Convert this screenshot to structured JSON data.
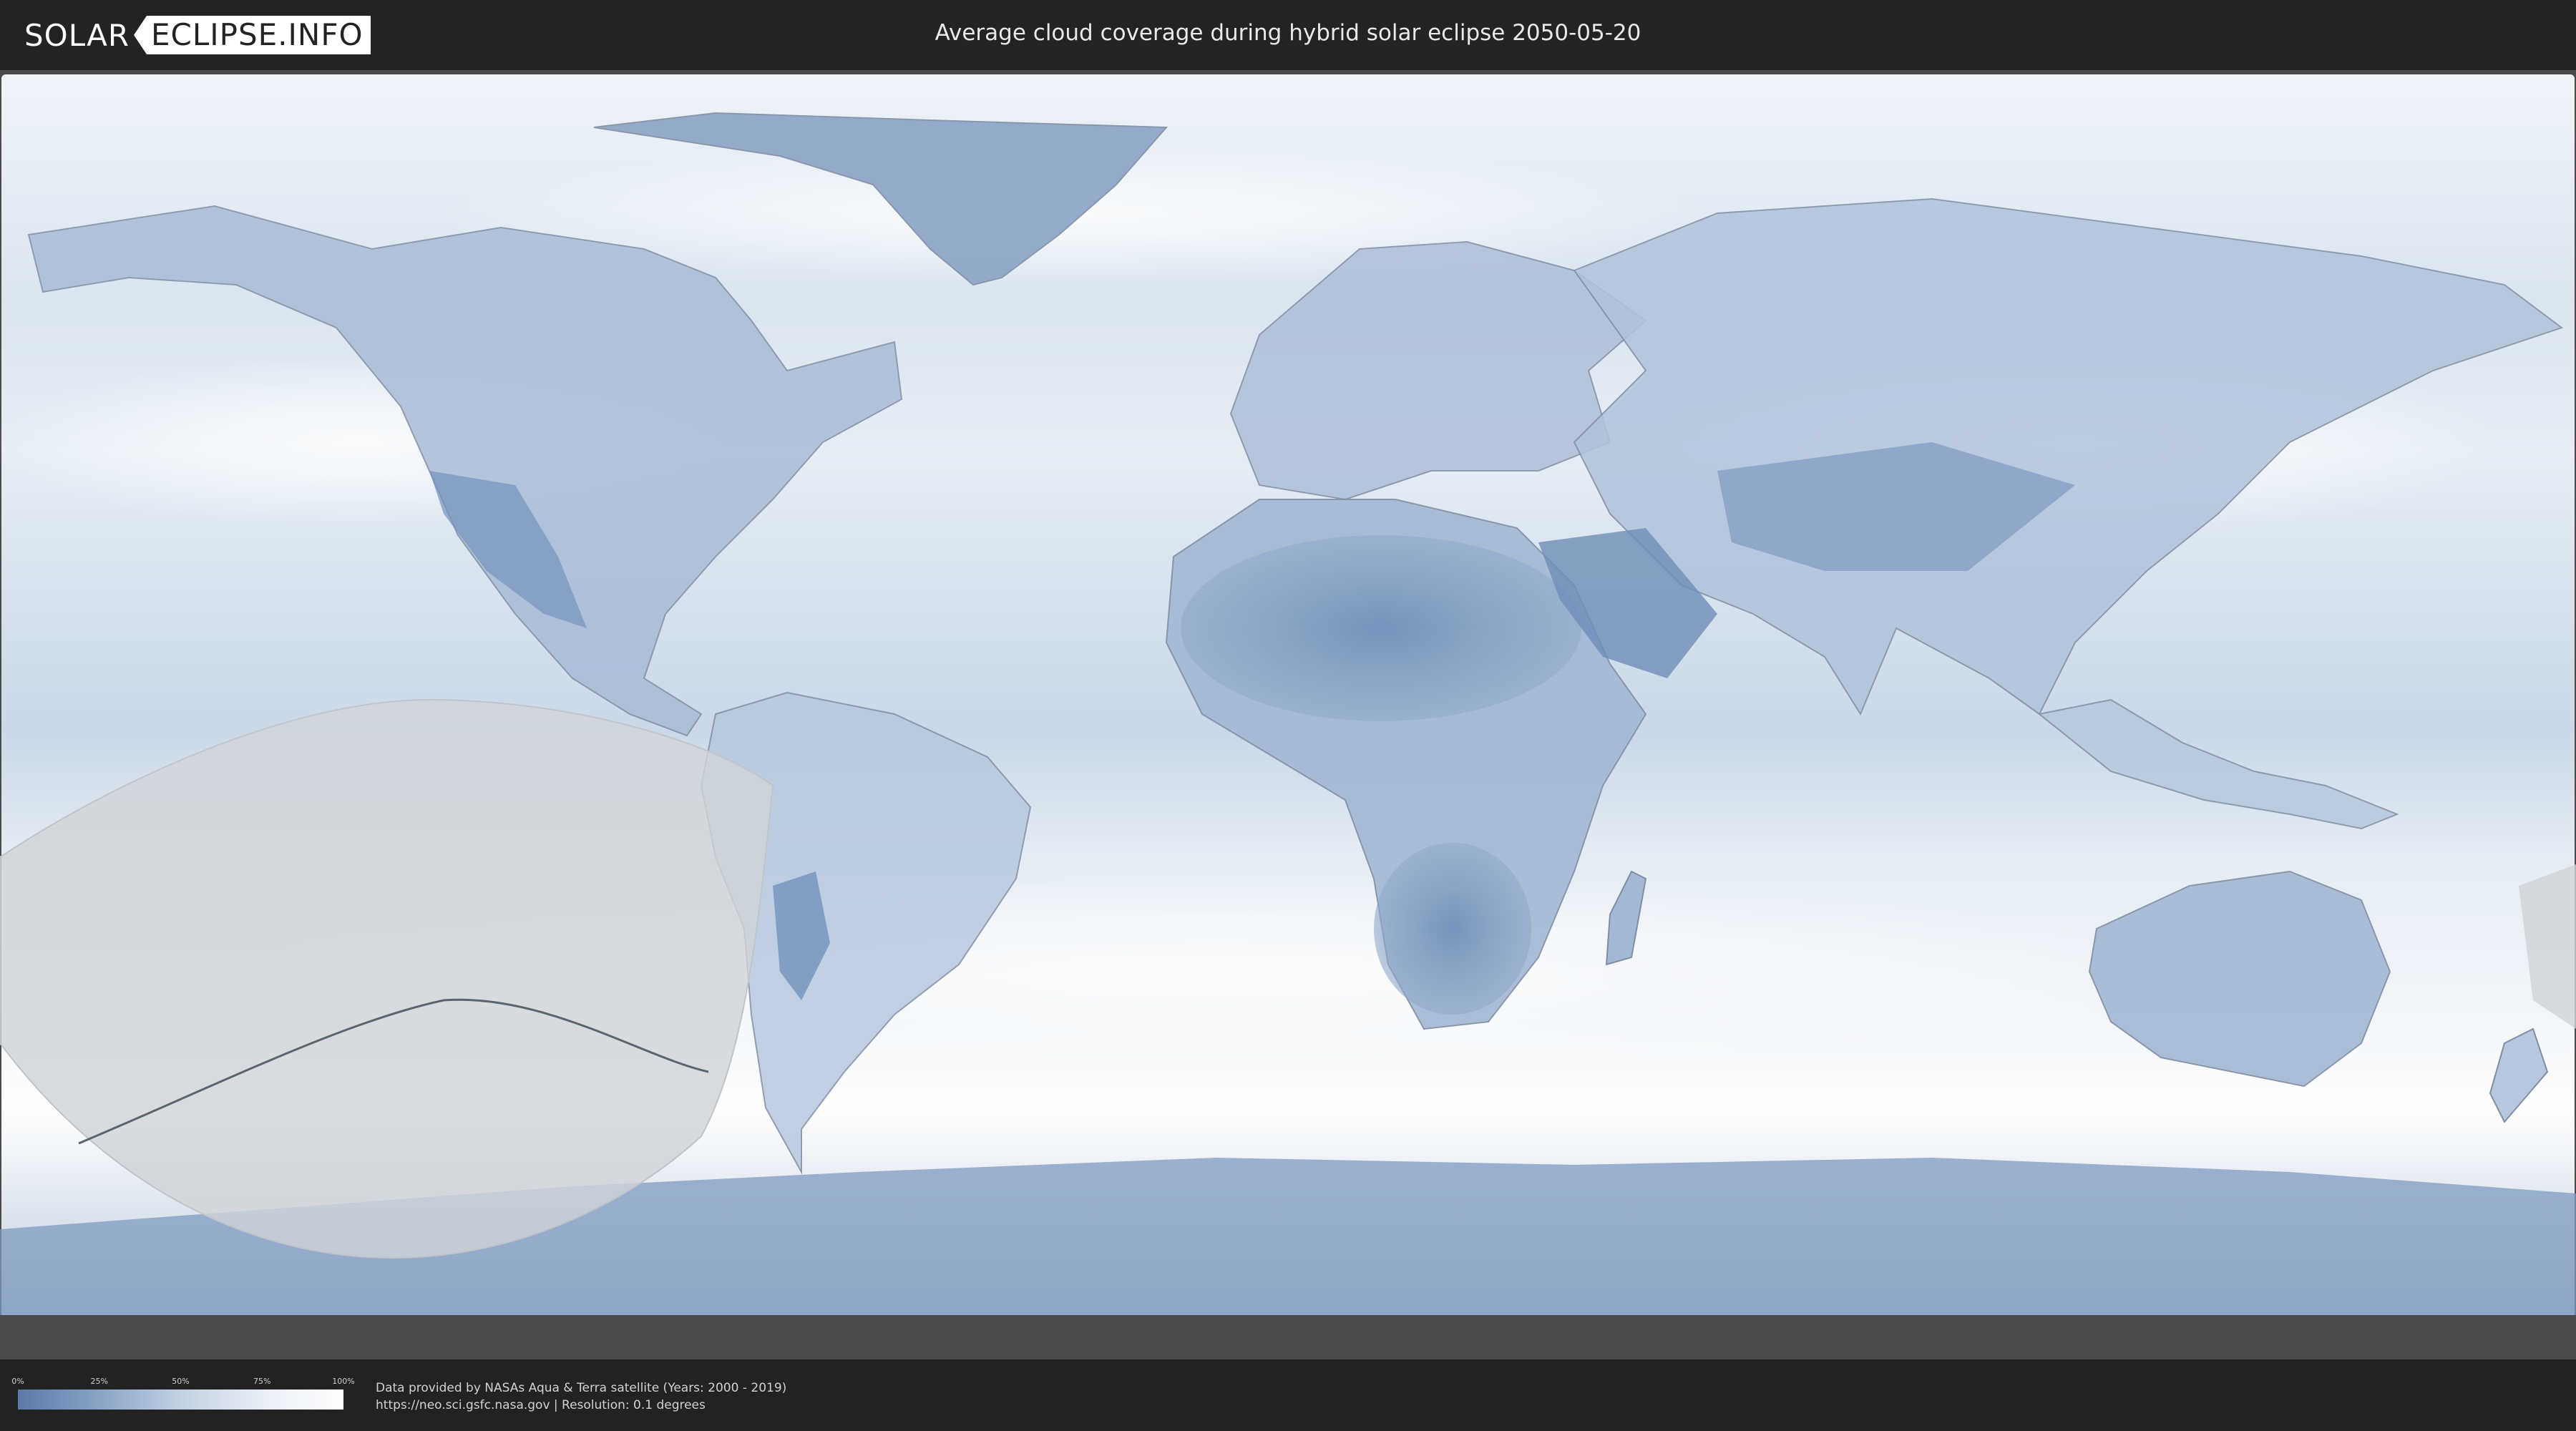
{
  "header": {
    "logo_left": "SOLAR",
    "logo_right": "ECLIPSE.INFO",
    "title": "Average cloud coverage during hybrid solar eclipse 2050-05-20"
  },
  "map": {
    "type": "cloud-coverage-world-map",
    "colors": {
      "ocean_clear": "#e7eef6",
      "cloud_dark": "#6f8db8",
      "cloud_light": "#f3f7fb",
      "eclipse_zone": "#cfd3d7",
      "frame": "#4a4a4a"
    }
  },
  "legend": {
    "ticks": [
      "0%",
      "25%",
      "50%",
      "75%",
      "100%"
    ],
    "colors": [
      "#5a7aa8",
      "#8aa3c6",
      "#c3d1e3",
      "#e9eef5",
      "#ffffff"
    ]
  },
  "footer": {
    "credit_line1": "Data provided by NASAs Aqua & Terra satellite (Years: 2000 - 2019)",
    "credit_line2": "https://neo.sci.gsfc.nasa.gov | Resolution: 0.1 degrees"
  }
}
